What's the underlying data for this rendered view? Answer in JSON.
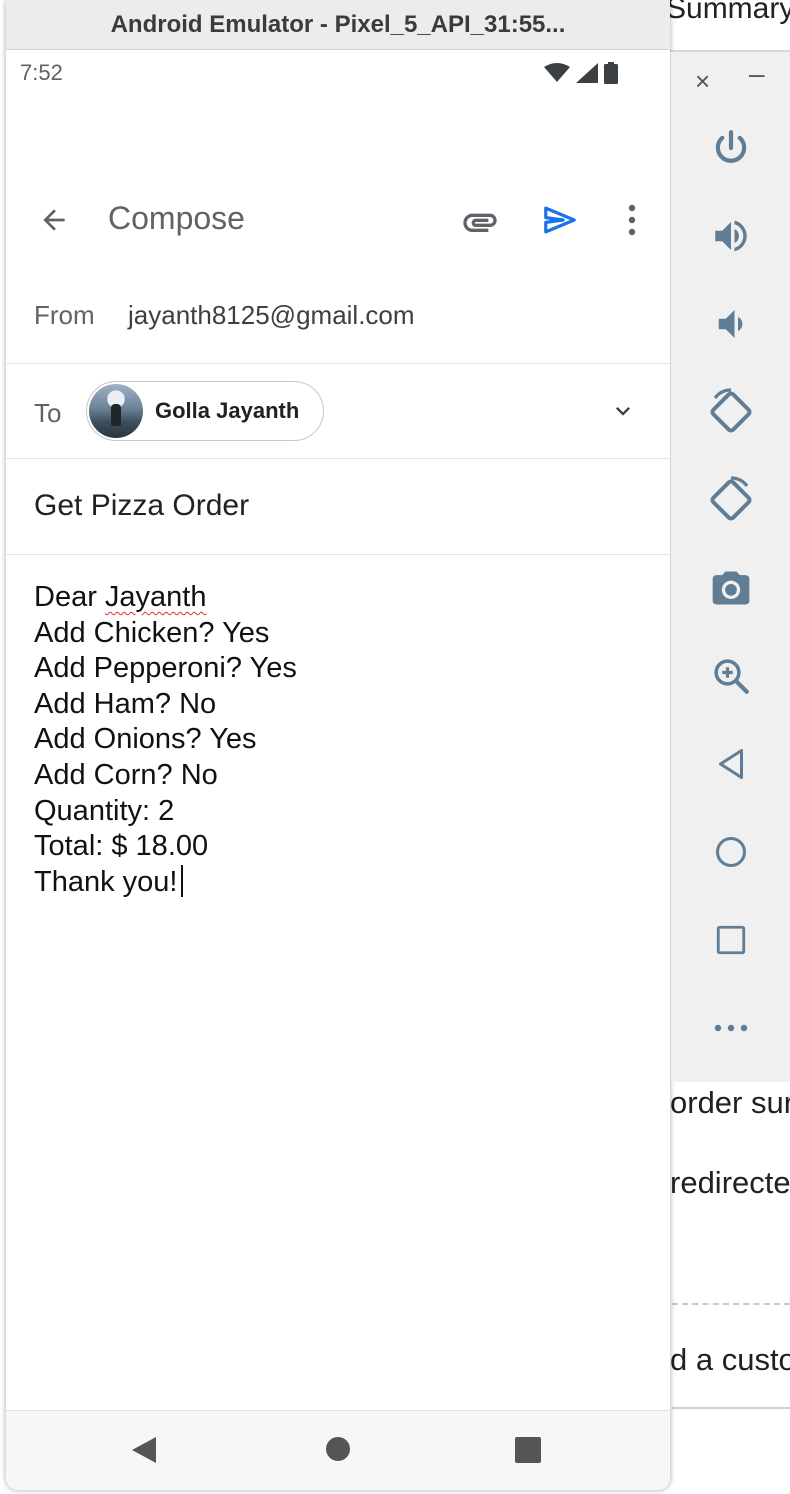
{
  "emulator": {
    "window_title": "Android Emulator - Pixel_5_API_31:55..."
  },
  "status_bar": {
    "time": "7:52"
  },
  "compose": {
    "title": "Compose",
    "from_label": "From",
    "from_value": "jayanth8125@gmail.com",
    "to_label": "To",
    "recipient_name": "Golla Jayanth",
    "subject": "Get Pizza Order",
    "body_lines": [
      "Dear Jayanth",
      "Add Chicken? Yes",
      "Add Pepperoni? Yes",
      "Add Ham? No",
      "Add Onions? Yes",
      "Add Corn? No",
      "Quantity: 2",
      "Total: $ 18.00",
      "Thank you!"
    ],
    "body_line0_prefix": "Dear ",
    "body_line0_misspelled": "Jayanth"
  },
  "toolbar": {
    "close_glyph": "×",
    "minimize_glyph": "–",
    "buttons": [
      "power-icon",
      "volume-up-icon",
      "volume-down-icon",
      "rotate-left-icon",
      "rotate-right-icon",
      "camera-icon",
      "zoom-icon",
      "back-icon",
      "home-icon",
      "overview-icon",
      "more-icon"
    ]
  },
  "background": {
    "top_right_text": "Summary",
    "right_text_1": "order sur",
    "right_text_2": "redirecte",
    "right_text_3": "d a custor"
  },
  "colors": {
    "send_icon": "#1a73e8",
    "spellcheck_underline": "#d93025",
    "toolbar_icons": "#5f7d95"
  }
}
